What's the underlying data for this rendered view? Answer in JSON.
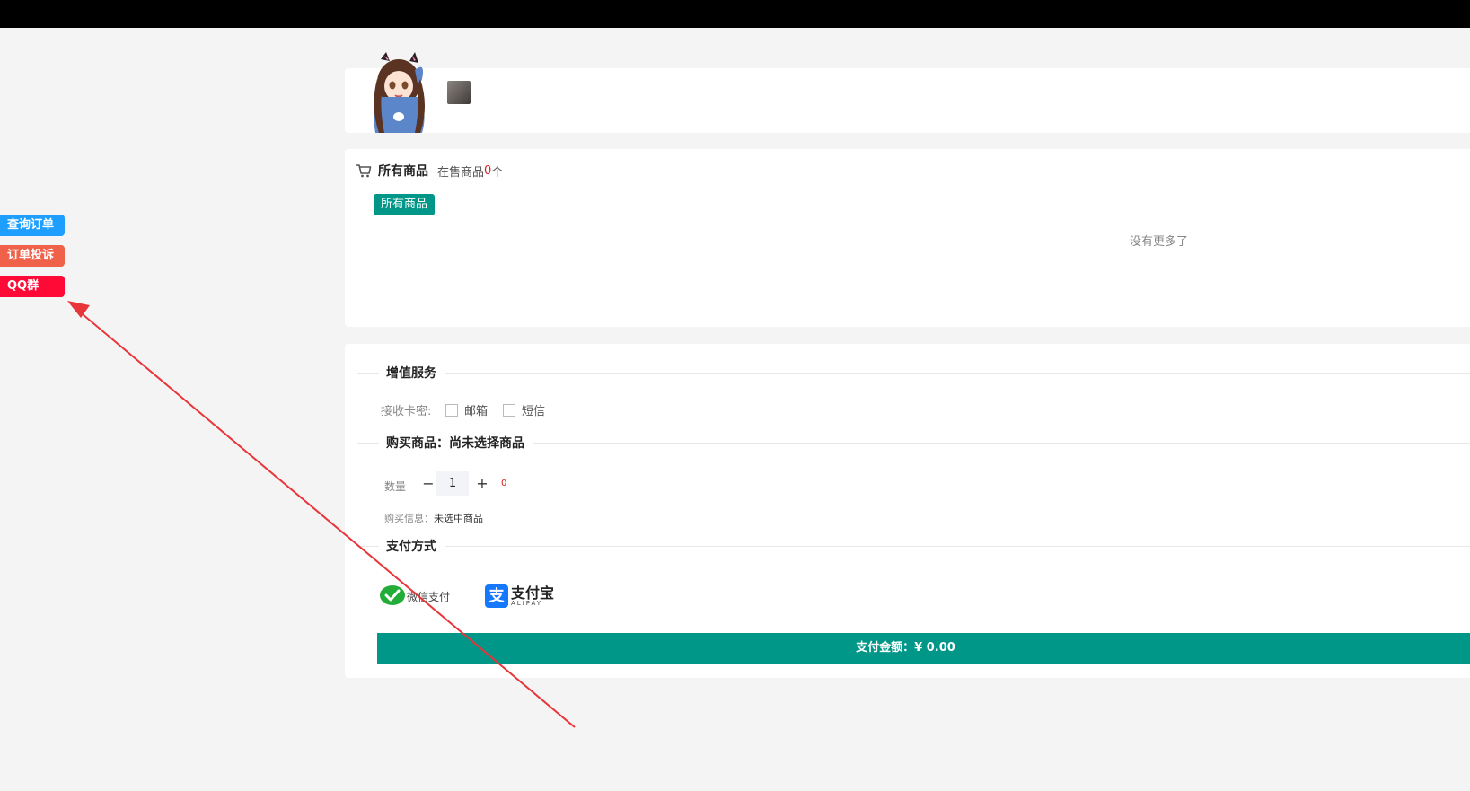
{
  "side_buttons": {
    "query_order": "查询订单",
    "complaint": "订单投诉",
    "qq_group": "QQ群"
  },
  "goods": {
    "title": "所有商品",
    "on_sale_label": "在售商品",
    "on_sale_count": "0",
    "on_sale_unit": "个",
    "category_tag": "所有商品",
    "empty_text": "没有更多了"
  },
  "order": {
    "value_added_title": "增值服务",
    "receive_label": "接收卡密:",
    "email_option": "邮箱",
    "sms_option": "短信",
    "buy_goods_title": "购买商品：尚未选择商品",
    "quantity_label": "数量",
    "quantity_value": "1",
    "minus": "−",
    "plus": "+",
    "stock": "0",
    "buy_info_label": "购买信息：",
    "buy_info_value": "未选中商品",
    "payment_title": "支付方式",
    "wechat_label": "微信支付",
    "alipay_cn": "支付宝",
    "alipay_en": "ALIPAY",
    "pay_button": "支付金额：¥ 0.00"
  },
  "colors": {
    "primary_teal": "#009688",
    "query_blue": "#1e9fff",
    "complaint_orange": "#f0614a",
    "qq_red": "#ff0a36",
    "annotation_arrow": "#e8353a"
  }
}
